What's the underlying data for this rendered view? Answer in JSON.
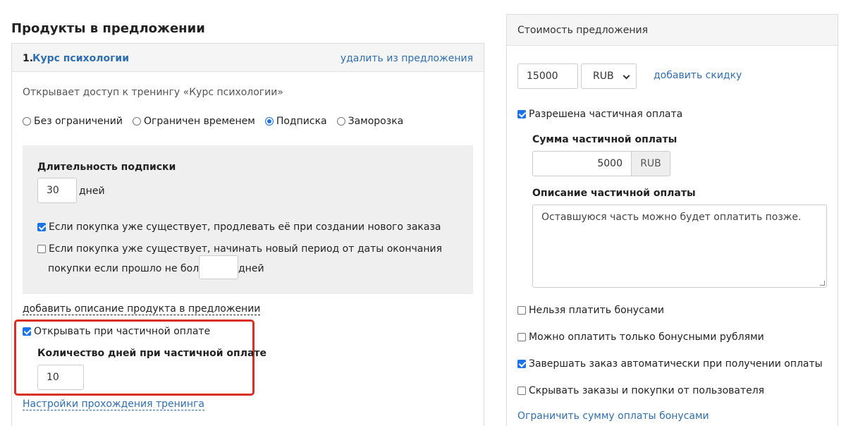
{
  "section_title": "Продукты в предложении",
  "product": {
    "number": "1.",
    "name": "Курс психологии",
    "remove_label": "удалить из предложения",
    "access_text": "Открывает доступ к тренингу «Курс психологии»",
    "access_options": [
      {
        "label": "Без ограничений",
        "checked": false
      },
      {
        "label": "Ограничен временем",
        "checked": false
      },
      {
        "label": "Подписка",
        "checked": true
      },
      {
        "label": "Заморозка",
        "checked": false
      }
    ],
    "subscription": {
      "duration_title": "Длительность подписки",
      "duration_value": "30",
      "duration_unit": "дней",
      "extend_label": "Если покупка уже существует, продлевать её при создании нового заказа",
      "extend_checked": true,
      "new_period_label_line1": "Если покупка уже существует, начинать новый период от даты окончания",
      "new_period_label_line2": "покупки если прошло не более",
      "new_period_checked": false,
      "new_period_value": "",
      "new_period_unit": "дней"
    },
    "add_description_label": "добавить описание продукта в предложении",
    "open_on_partial_label": "Открывать при частичной оплате",
    "open_on_partial_checked": true,
    "partial_days_title": "Количество дней при частичной оплате",
    "partial_days_value": "10",
    "training_settings_label": "Настройки прохождения тренинга"
  },
  "price": {
    "title": "Стоимость предложения",
    "amount": "15000",
    "currency": "RUB",
    "add_discount_label": "добавить скидку",
    "allow_partial_label": "Разрешена частичная оплата",
    "allow_partial_checked": true,
    "partial_sum_title": "Сумма частичной оплаты",
    "partial_sum_value": "5000",
    "partial_sum_currency": "RUB",
    "partial_desc_title": "Описание частичной оплаты",
    "partial_desc_value": "Оставшуюся часть можно будет оплатить позже.",
    "options": [
      {
        "label": "Нельзя платить бонусами",
        "checked": false
      },
      {
        "label": "Можно оплатить только бонусными рублями",
        "checked": false
      },
      {
        "label": "Завершать заказ автоматически при получении оплаты",
        "checked": true
      },
      {
        "label": "Скрывать заказы и покупки от пользователя",
        "checked": false
      }
    ],
    "limit_bonus_label": "Ограничить сумму оплаты бонусами"
  },
  "colors": {
    "link": "#2f6fb1",
    "highlight": "#d93025",
    "check": "#1a73e8"
  }
}
